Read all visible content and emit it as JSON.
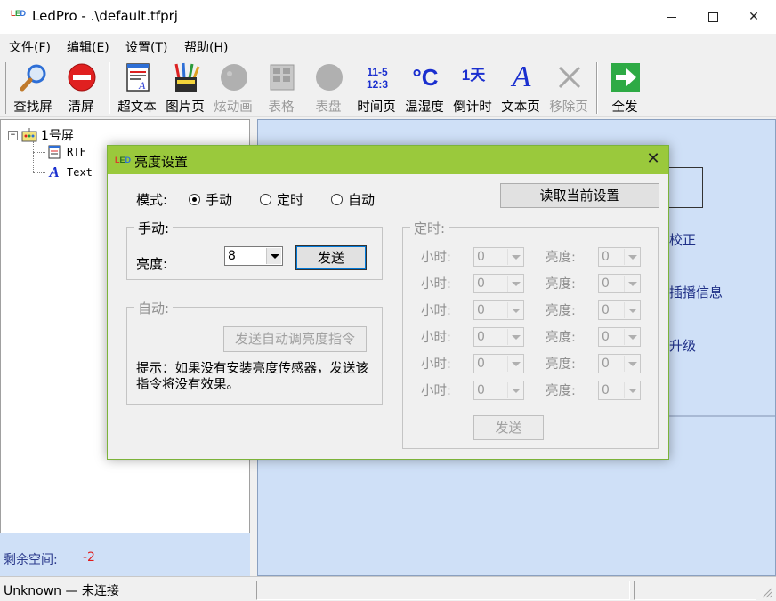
{
  "window": {
    "title": "LedPro - .\\default.tfprj",
    "logo": "LED"
  },
  "menu": [
    "文件(F)",
    "编辑(E)",
    "设置(T)",
    "帮助(H)"
  ],
  "toolbar": {
    "find_screen": "查找屏",
    "clear_screen": "清屏",
    "rich_text": "超文本",
    "picture_page": "图片页",
    "animation": "炫动画",
    "table": "表格",
    "dial": "表盘",
    "time_page": "时间页",
    "time_icon_top": "11-5",
    "time_icon_bottom": "12:3",
    "temperature": "温湿度",
    "temperature_icon": "°C",
    "countdown": "倒计时",
    "countdown_icon": "1天",
    "text_page": "文本页",
    "text_icon": "A",
    "remove_page": "移除页",
    "send_all": "全发"
  },
  "tree": {
    "root": "1号屏",
    "toggle": "−",
    "children": [
      "RTF",
      "Text"
    ]
  },
  "left_footer": {
    "label": "剩余空间:",
    "value": "-2"
  },
  "right_panel": {
    "links": [
      "校正",
      "插播信息",
      "升级"
    ]
  },
  "status": {
    "connection": "Unknown — 未连接"
  },
  "colors": {
    "dialog_title": "#9ac93c",
    "panel_bg": "#cfe0f7",
    "warn": "#e01b1b"
  },
  "dialog": {
    "title": "亮度设置",
    "logo": "LED",
    "close": "✕",
    "mode_label": "模式:",
    "modes": [
      {
        "label": "手动",
        "checked": true
      },
      {
        "label": "定时",
        "checked": false
      },
      {
        "label": "自动",
        "checked": false
      }
    ],
    "read_button": "读取当前设置",
    "manual": {
      "title": "手动:",
      "brightness_label": "亮度:",
      "brightness_value": "8",
      "send": "发送"
    },
    "auto": {
      "title": "自动:",
      "send_cmd": "发送自动调亮度指令",
      "hint": "提示：如果没有安装亮度传感器，发送该指令将没有效果。"
    },
    "schedule": {
      "title": "定时:",
      "hour_label": "小时:",
      "bright_label": "亮度:",
      "rows": [
        {
          "hour": "0",
          "brightness": "0"
        },
        {
          "hour": "0",
          "brightness": "0"
        },
        {
          "hour": "0",
          "brightness": "0"
        },
        {
          "hour": "0",
          "brightness": "0"
        },
        {
          "hour": "0",
          "brightness": "0"
        },
        {
          "hour": "0",
          "brightness": "0"
        }
      ],
      "send": "发送"
    }
  }
}
